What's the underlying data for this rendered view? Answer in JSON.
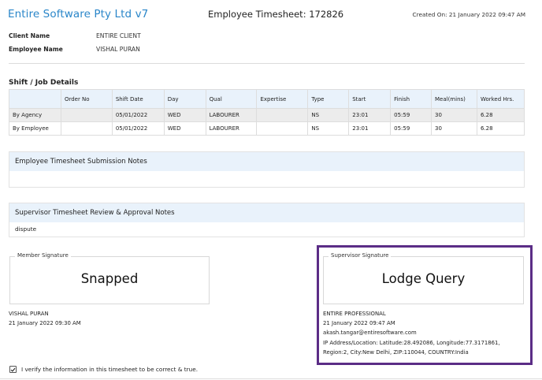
{
  "header": {
    "app_title": "Entire Software Pty Ltd v7",
    "sheet_title": "Employee Timesheet: 172826",
    "created_on": "Created On: 21 January 2022 09:47 AM"
  },
  "info": {
    "client_label": "Client Name",
    "client_value": "ENTIRE CLIENT",
    "employee_label": "Employee Name",
    "employee_value": "VISHAL PURAN"
  },
  "shift_section": {
    "title": "Shift / Job Details",
    "columns": [
      "",
      "Order No",
      "Shift Date",
      "Day",
      "Qual",
      "Expertise",
      "Type",
      "Start",
      "Finish",
      "Meal(mins)",
      "Worked Hrs."
    ],
    "rows": [
      [
        "By Agency",
        "",
        "05/01/2022",
        "WED",
        "LABOURER",
        "",
        "NS",
        "23:01",
        "05:59",
        "30",
        "6.28"
      ],
      [
        "By Employee",
        "",
        "05/01/2022",
        "WED",
        "LABOURER",
        "",
        "NS",
        "23:01",
        "05:59",
        "30",
        "6.28"
      ]
    ]
  },
  "employee_notes": {
    "title": "Employee Timesheet Submission Notes",
    "text": ""
  },
  "supervisor_notes": {
    "title": "Supervisor Timesheet Review & Approval Notes",
    "text": "dispute"
  },
  "member_signature": {
    "legend": "Member Signature",
    "text": "Snapped",
    "name": "VISHAL PURAN",
    "datetime": "21 January 2022 09:30 AM"
  },
  "supervisor_signature": {
    "legend": "Supervisor Signature",
    "text": "Lodge Query",
    "org": "ENTIRE PROFESSIONAL",
    "datetime": "21 January 2022 09:47 AM",
    "email": "akash.tangar@entiresoftware.com",
    "location_line1": "IP Address/Location: Latitude:28.492086, Longitude:77.3171861,",
    "location_line2": "Region:2, City:New Delhi, ZIP:110044, COUNTRY:India"
  },
  "verify": {
    "checked": true,
    "label": "I verify the information in this timesheet to be correct & true."
  },
  "colors": {
    "title_blue": "#2a86c9",
    "header_bg": "#e9f2fb",
    "highlight_purple": "#5b2d86"
  }
}
